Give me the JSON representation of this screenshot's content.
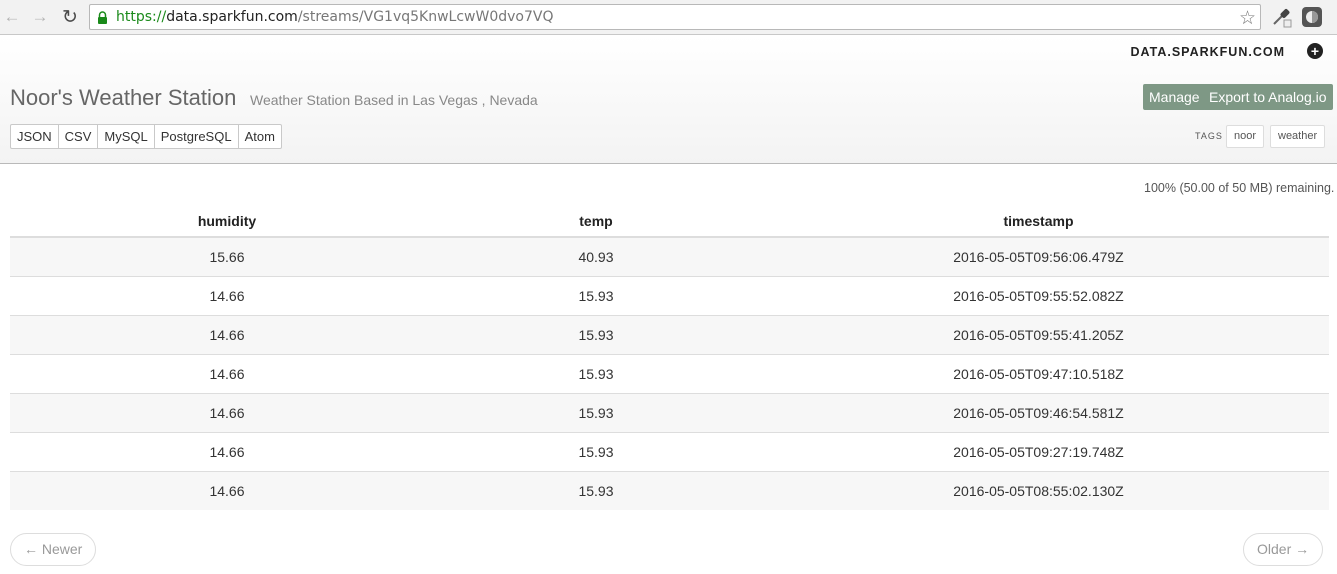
{
  "browser": {
    "url_scheme": "https://",
    "url_host": "data.sparkfun.com",
    "url_path": "/streams/VG1vq5KnwLcwW0dvo7VQ",
    "back_icon": "back-arrow-icon",
    "forward_icon": "forward-arrow-icon",
    "reload_icon": "reload-icon",
    "lock_icon": "lock-icon",
    "star_icon": "star-icon"
  },
  "header": {
    "brand": "DATA.SPARKFUN.COM",
    "title": "Noor's Weather Station",
    "subtitle": "Weather Station Based in Las Vegas , Nevada",
    "manage_label": "Manage",
    "export_label": "Export to Analog.io",
    "formats": [
      "JSON",
      "CSV",
      "MySQL",
      "PostgreSQL",
      "Atom"
    ],
    "tags_label": "TAGS",
    "tags": [
      "noor",
      "weather"
    ],
    "accent_color": "#7e9885"
  },
  "storage": {
    "remaining": "100% (50.00 of 50 MB) remaining."
  },
  "table": {
    "columns": [
      "humidity",
      "temp",
      "timestamp"
    ],
    "rows": [
      [
        "15.66",
        "40.93",
        "2016-05-05T09:56:06.479Z"
      ],
      [
        "14.66",
        "15.93",
        "2016-05-05T09:55:52.082Z"
      ],
      [
        "14.66",
        "15.93",
        "2016-05-05T09:55:41.205Z"
      ],
      [
        "14.66",
        "15.93",
        "2016-05-05T09:47:10.518Z"
      ],
      [
        "14.66",
        "15.93",
        "2016-05-05T09:46:54.581Z"
      ],
      [
        "14.66",
        "15.93",
        "2016-05-05T09:27:19.748Z"
      ],
      [
        "14.66",
        "15.93",
        "2016-05-05T08:55:02.130Z"
      ]
    ]
  },
  "pager": {
    "newer_label": "← Newer",
    "older_label": "Older →"
  }
}
